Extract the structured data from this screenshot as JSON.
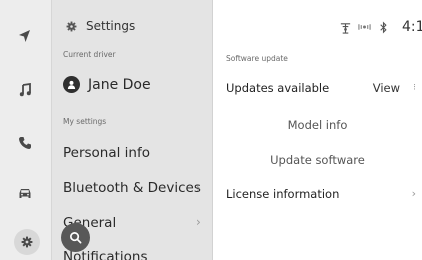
{
  "rail": {
    "items": [
      {
        "name": "navigation",
        "icon": "navigation-arrow-icon"
      },
      {
        "name": "media",
        "icon": "music-note-icon"
      },
      {
        "name": "phone",
        "icon": "phone-icon"
      },
      {
        "name": "vehicle",
        "icon": "car-icon"
      },
      {
        "name": "settings",
        "icon": "gear-icon",
        "active": true
      }
    ]
  },
  "settings_list": {
    "title": "Settings",
    "current_driver_label": "Current driver",
    "driver_name": "Jane Doe",
    "my_settings_label": "My settings",
    "items": [
      {
        "label": "Personal info",
        "has_chevron": false
      },
      {
        "label": "Bluetooth & Devices",
        "has_chevron": true
      },
      {
        "label": "General",
        "has_chevron": true
      },
      {
        "label": "Notifications",
        "has_chevron": false
      }
    ],
    "chevron": "›"
  },
  "search": {
    "icon": "search-icon"
  },
  "status_bar": {
    "icons": [
      "antenna-icon",
      "wifi-calling-icon",
      "bluetooth-icon"
    ],
    "clock": "4:1"
  },
  "detail": {
    "section_label": "Software update",
    "updates_label": "Updates available",
    "view_label": "View",
    "more_glyph": "⁝",
    "model_info_label": "Model info",
    "update_software_label": "Update software",
    "license_label": "License information",
    "chevron": "›"
  },
  "colors": {
    "rail_bg": "#ededed",
    "list_bg": "#e4e4e4",
    "detail_bg": "#ffffff",
    "fab_bg": "#585858"
  }
}
